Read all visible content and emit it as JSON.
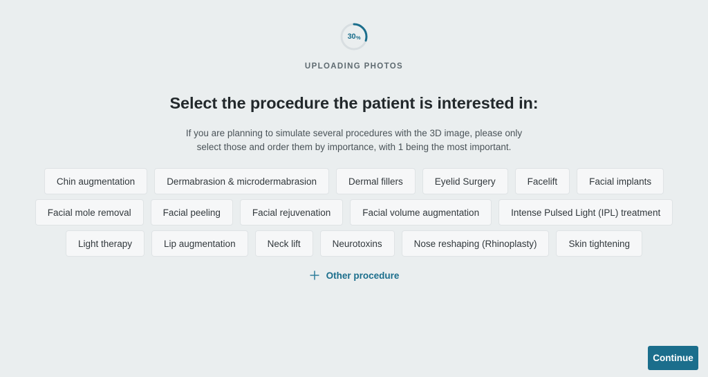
{
  "upload": {
    "percent_value": "30",
    "percent_sign": "%",
    "percent_number": 30,
    "status_label": "UPLOADING PHOTOS",
    "ring_color": "#1b6e8c",
    "ring_track_color": "#d8dee1"
  },
  "content": {
    "heading": "Select the procedure the patient is interested in:",
    "subtitle": "If you are planning to simulate several procedures with the 3D image, please only select those and order them by importance, with 1 being the most important."
  },
  "procedures": {
    "rows": [
      [
        "Chin augmentation",
        "Dermabrasion & microdermabrasion",
        "Dermal fillers",
        "Eyelid Surgery",
        "Facelift",
        "Facial implants"
      ],
      [
        "Facial mole removal",
        "Facial peeling",
        "Facial rejuvenation",
        "Facial volume augmentation",
        "Intense Pulsed Light (IPL) treatment"
      ],
      [
        "Light therapy",
        "Lip augmentation",
        "Neck lift",
        "Neurotoxins",
        "Nose reshaping (Rhinoplasty)",
        "Skin tightening"
      ]
    ]
  },
  "other_procedure": {
    "label": "Other procedure",
    "icon": "plus-icon",
    "color": "#1b6e8c"
  },
  "footer": {
    "continue_label": "Continue",
    "continue_color": "#1b6e8c"
  }
}
